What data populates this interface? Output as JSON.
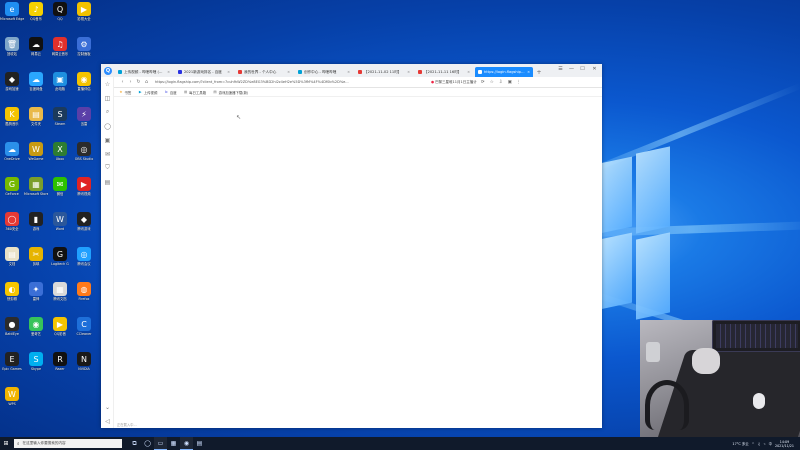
{
  "desktop_icons": [
    {
      "label": "Microsoft Edge",
      "color": "#1f8ef1",
      "glyph": "e"
    },
    {
      "label": "QQ音乐",
      "color": "#f5d100",
      "glyph": "♪"
    },
    {
      "label": "QQ",
      "color": "#111111",
      "glyph": "Q"
    },
    {
      "label": "影视大全",
      "color": "#f2c200",
      "glyph": "▶"
    },
    {
      "label": "回收站",
      "color": "#7fa6c9",
      "glyph": "🗑"
    },
    {
      "label": "网易云",
      "color": "#111111",
      "glyph": "☁"
    },
    {
      "label": "网易云音乐",
      "color": "#e0302c",
      "glyph": "♫"
    },
    {
      "label": "控制面板",
      "color": "#3a6ed6",
      "glyph": "⚙"
    },
    {
      "label": "游戏加速",
      "color": "#222222",
      "glyph": "◆"
    },
    {
      "label": "百度网盘",
      "color": "#2aa6ff",
      "glyph": "☁"
    },
    {
      "label": "此电脑",
      "color": "#1e8fe0",
      "glyph": "▣"
    },
    {
      "label": "直播伴侣",
      "color": "#f4c400",
      "glyph": "◉"
    },
    {
      "label": "酷狗音乐",
      "color": "#f4c400",
      "glyph": "K"
    },
    {
      "label": "文件夹",
      "color": "#e9b949",
      "glyph": "▤"
    },
    {
      "label": "Steam",
      "color": "#1b3a5c",
      "glyph": "S"
    },
    {
      "label": "迅雷",
      "color": "#5a3fa8",
      "glyph": "⚡"
    },
    {
      "label": "OneDrive",
      "color": "#2b90ea",
      "glyph": "☁"
    },
    {
      "label": "WeGame",
      "color": "#c89a12",
      "glyph": "W"
    },
    {
      "label": "Xbox",
      "color": "#2e7d32",
      "glyph": "X"
    },
    {
      "label": "OBS Studio",
      "color": "#2b2b2b",
      "glyph": "◎"
    },
    {
      "label": "GeForce",
      "color": "#76b900",
      "glyph": "G"
    },
    {
      "label": "Microsoft Store",
      "color": "#7a9e2a",
      "glyph": "▦"
    },
    {
      "label": "微信",
      "color": "#2dc100",
      "glyph": "✉"
    },
    {
      "label": "腾讯视频",
      "color": "#e02323",
      "glyph": "▶"
    },
    {
      "label": "360安全",
      "color": "#e53935",
      "glyph": "◯"
    },
    {
      "label": "游戏",
      "color": "#222222",
      "glyph": "▮"
    },
    {
      "label": "Word",
      "color": "#2b579a",
      "glyph": "W"
    },
    {
      "label": "腾讯游戏",
      "color": "#222222",
      "glyph": "◆"
    },
    {
      "label": "文档",
      "color": "#e9e2c7",
      "glyph": "▤"
    },
    {
      "label": "剪映",
      "color": "#e6b400",
      "glyph": "✂"
    },
    {
      "label": "Logitech G",
      "color": "#111111",
      "glyph": "G"
    },
    {
      "label": "腾讯会议",
      "color": "#20a0ff",
      "glyph": "◎"
    },
    {
      "label": "快剪辑",
      "color": "#f6c600",
      "glyph": "◐"
    },
    {
      "label": "雷神",
      "color": "#3b6fd6",
      "glyph": "✦"
    },
    {
      "label": "腾讯文档",
      "color": "#d9d9d9",
      "glyph": "▦"
    },
    {
      "label": "Firefox",
      "color": "#ff7a1a",
      "glyph": "◍"
    },
    {
      "label": "BattlEye",
      "color": "#2c2c2c",
      "glyph": "●"
    },
    {
      "label": "爱奇艺",
      "color": "#37c35a",
      "glyph": "◉"
    },
    {
      "label": "QQ影音",
      "color": "#f4c400",
      "glyph": "▶"
    },
    {
      "label": "CCleaner",
      "color": "#1e6fd9",
      "glyph": "C"
    },
    {
      "label": "Epic Games",
      "color": "#222222",
      "glyph": "E"
    },
    {
      "label": "Skype",
      "color": "#00aff0",
      "glyph": "S"
    },
    {
      "label": "Razer",
      "color": "#111111",
      "glyph": "R"
    },
    {
      "label": "NVIDIA",
      "color": "#1a1a1a",
      "glyph": "N"
    },
    {
      "label": "WPS",
      "color": "#f0b400",
      "glyph": "W"
    }
  ],
  "browser": {
    "logo": "Q",
    "tabs": [
      {
        "label": "上传视频 - 哔哩哔哩 (゜-゜)つロ",
        "active": false,
        "fav_color": "#00a1d6"
      },
      {
        "label": "2021新游戏排名 - 百度",
        "active": false,
        "fav_color": "#2932e1"
      },
      {
        "label": "我的世界 - 个人中心",
        "active": false,
        "fav_color": "#e53935"
      },
      {
        "label": "创作中心 - 哔哩哔哩",
        "active": false,
        "fav_color": "#00a1d6"
      },
      {
        "label": "【2021-11-02 11时】",
        "active": false,
        "fav_color": "#e53935"
      },
      {
        "label": "【2021-11-11 16时】",
        "active": false,
        "fav_color": "#e53935"
      },
      {
        "label": "https://login.flagship.cn",
        "active": true,
        "fav_color": "#ffffff"
      }
    ],
    "new_tab": "+",
    "window_controls": [
      "☰",
      "—",
      "☐",
      "✕"
    ],
    "nav": {
      "back": "‹",
      "forward": "›",
      "refresh": "↻",
      "home": "⌂"
    },
    "url": "https://login.flagship.com/?client_from=7cuhfhW2ZD%e8EG3%BD2hl2z4eH2e%5D%3fM%4F%4Df0b%2D%e...",
    "search_hint": "巴黎三星堆11月1日主播计",
    "toolbar_icons": [
      "⟳",
      "☆",
      "⇩",
      "▣",
      "⋮"
    ],
    "bookmarks": [
      {
        "label": "书签",
        "color": "#f5a623",
        "glyph": "★"
      },
      {
        "label": "上传视频",
        "color": "#00a1d6",
        "glyph": "▶"
      },
      {
        "label": "百度",
        "color": "#2932e1",
        "glyph": "b"
      },
      {
        "label": "每日工具箱",
        "color": "#999999",
        "glyph": "▦"
      },
      {
        "label": "游戏加速器下载(新)",
        "color": "#777777",
        "glyph": "▤"
      }
    ],
    "sidebar_icons": [
      "☆",
      "◫",
      "⌕",
      "◯",
      "▣",
      "✉",
      "⛉",
      "▤"
    ],
    "sidebar_bottom": [
      "⌄",
      "◁"
    ],
    "status_text": "正在载入中..."
  },
  "taskbar": {
    "start_glyph": "⊞",
    "search_placeholder": "在这里输入你要搜索的内容",
    "search_icon": "⌕",
    "apps": [
      {
        "glyph": "⧉",
        "active": false
      },
      {
        "glyph": "◯",
        "active": false
      },
      {
        "glyph": "▭",
        "active": true
      },
      {
        "glyph": "▦",
        "active": false
      },
      {
        "glyph": "◉",
        "active": true
      },
      {
        "glyph": "▤",
        "active": false
      }
    ],
    "weather": "17°C 多云",
    "tray_icons": [
      "^",
      "♫",
      "⌁",
      "中"
    ],
    "time": "14:09",
    "date": "2021/11/21"
  }
}
